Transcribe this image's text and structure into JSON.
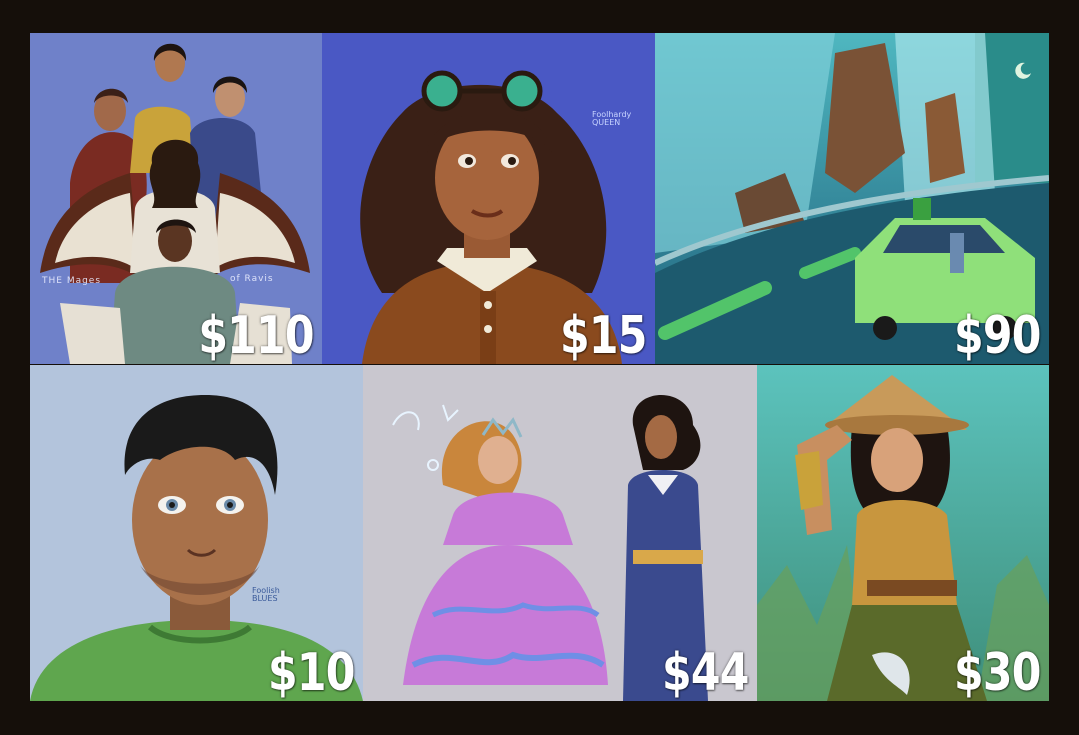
{
  "sheet": {
    "background": "#150f0a",
    "tiles": [
      {
        "name": "mages-of-ravis",
        "price": "$110",
        "caption_left": "THE Mages",
        "caption_right": "of Ravis",
        "background": "#6f81c9"
      },
      {
        "name": "goggles-girl",
        "price": "$15",
        "signature": "Foolhardy QUEEN",
        "background": "#4a58c4"
      },
      {
        "name": "waterfall-car",
        "price": "$90",
        "background": "#1f6f84"
      },
      {
        "name": "boy-portrait",
        "price": "$10",
        "signature": "Foolish BLUES",
        "background": "#b3c4dc"
      },
      {
        "name": "princess-and-captain",
        "price": "$44",
        "background": "#c9c7cf"
      },
      {
        "name": "warrior-woman",
        "price": "$30",
        "background": "#56b3ae"
      }
    ]
  }
}
